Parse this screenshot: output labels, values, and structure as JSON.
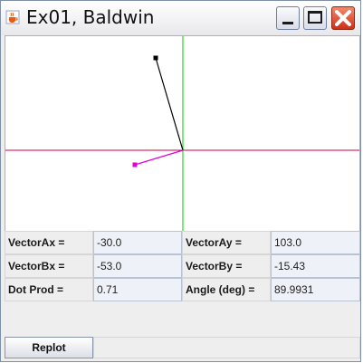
{
  "window": {
    "title": "Ex01, Baldwin",
    "icons": {
      "app": "java-cup-icon",
      "minimize": "minimize-icon",
      "maximize": "maximize-icon",
      "close": "close-icon"
    }
  },
  "fields": {
    "vector_ax": {
      "label": "VectorAx =",
      "value": "-30.0"
    },
    "vector_ay": {
      "label": "VectorAy =",
      "value": "103.0"
    },
    "vector_bx": {
      "label": "VectorBx =",
      "value": "-53.0"
    },
    "vector_by": {
      "label": "VectorBy =",
      "value": "-15.43"
    },
    "dot_prod": {
      "label": "Dot Prod =",
      "value": "0.71"
    },
    "angle": {
      "label": "Angle (deg) =",
      "value": "89.9931"
    }
  },
  "replot_label": "Replot",
  "colors": {
    "x_axis": "#cc0044",
    "y_axis": "#00cc00",
    "vector_a": "#000000",
    "vector_b": "#dd00dd"
  }
}
